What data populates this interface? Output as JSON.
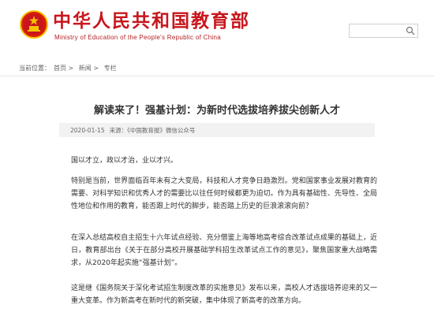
{
  "header": {
    "title_cn": "中华人民共和国教育部",
    "title_en": "Ministry of Education of the People's Republic of China",
    "search_placeholder": ""
  },
  "breadcrumb": {
    "prefix": "当前位置：",
    "items": [
      "首页",
      "新闻",
      "专栏"
    ],
    "separator": ">"
  },
  "article": {
    "title": "解读来了！强基计划：为新时代选拔培养拔尖创新人才",
    "date": "2020-01-15",
    "source_label": "来源：",
    "source": "《中国教育报》微信公众号",
    "paragraphs": [
      "国以才立，政以才治，业以才兴。",
      "特别是当前，世界面临百年未有之大变局，科技和人才竞争日趋激烈。党和国家事业发展对教育的需要、对科学知识和优秀人才的需要比以往任何时候都更为迫切。作为具有基础性、先导性、全局性地位和作用的教育，能否跟上时代的脚步，能否踏上历史的巨浪滚滚向前？",
      "在深入总结高校自主招生十六年试点经验、充分借鉴上海等地高考综合改革试点成果的基础上，近日，教育部出台《关于在部分高校开展基础学科招生改革试点工作的意见》，聚焦国家重大战略需求，从2020年起实施“强基计划”。",
      "这是继《国务院关于深化考试招生制度改革的实施意见》发布以来，高校人才选拔培养迎来的又一重大变革。作为新高考在新时代的新突破，集中体现了新高考的改革方向。"
    ]
  },
  "colors": {
    "brand": "#c8161d",
    "meta_bg": "#f2f2f2"
  }
}
